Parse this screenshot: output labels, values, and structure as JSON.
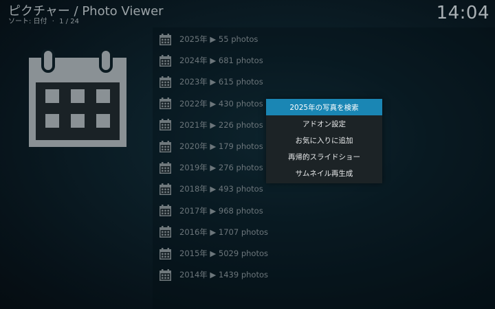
{
  "header": {
    "title": "ピクチャー / Photo Viewer",
    "sort_label": "ソート: 日付",
    "separator": "·",
    "position": "1 / 24",
    "clock": "14:04"
  },
  "list": {
    "items": [
      {
        "label": "2025年 ▶ 55 photos",
        "icon": "calendar-icon"
      },
      {
        "label": "2024年 ▶ 681 photos",
        "icon": "calendar-icon"
      },
      {
        "label": "2023年 ▶ 615 photos",
        "icon": "calendar-icon"
      },
      {
        "label": "2022年 ▶ 430 photos",
        "icon": "calendar-icon"
      },
      {
        "label": "2021年 ▶ 226 photos",
        "icon": "calendar-icon"
      },
      {
        "label": "2020年 ▶ 179 photos",
        "icon": "calendar-icon"
      },
      {
        "label": "2019年 ▶ 276 photos",
        "icon": "calendar-icon"
      },
      {
        "label": "2018年 ▶ 493 photos",
        "icon": "calendar-icon"
      },
      {
        "label": "2017年 ▶ 968 photos",
        "icon": "calendar-icon"
      },
      {
        "label": "2016年 ▶ 1707 photos",
        "icon": "calendar-icon"
      },
      {
        "label": "2015年 ▶ 5029 photos",
        "icon": "calendar-icon"
      },
      {
        "label": "2014年 ▶ 1439 photos",
        "icon": "calendar-icon"
      }
    ]
  },
  "context_menu": {
    "items": [
      {
        "label": "2025年の写真を検索",
        "selected": true
      },
      {
        "label": "アドオン設定",
        "selected": false
      },
      {
        "label": "お気に入りに追加",
        "selected": false
      },
      {
        "label": "再帰的スライドショー",
        "selected": false
      },
      {
        "label": "サムネイル再生成",
        "selected": false
      }
    ]
  },
  "colors": {
    "highlight": "#1a86b4",
    "menu_bg": "#1c2326",
    "icon_gray": "#8a9195"
  }
}
